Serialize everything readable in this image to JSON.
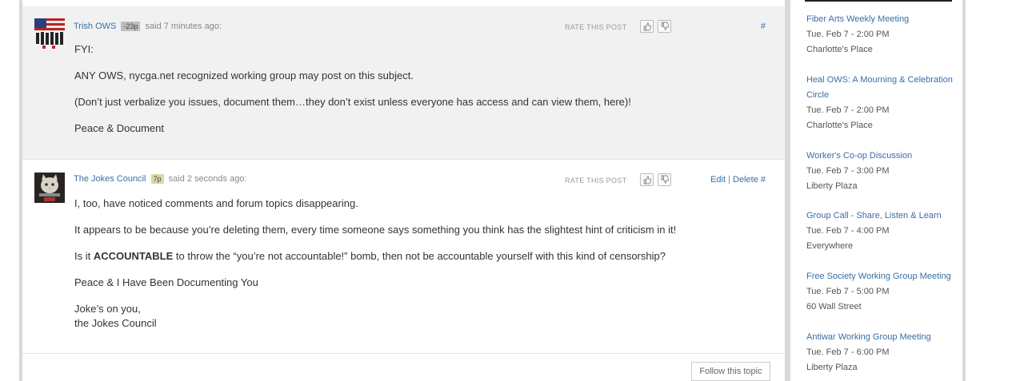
{
  "posts": [
    {
      "author": "Trish OWS",
      "rep": "-23p",
      "said": "said 7 minutes ago:",
      "rate_label": "RATE THIS POST",
      "actions": {
        "link": "#"
      },
      "body": [
        "FYI:",
        "ANY OWS, nycga.net recognized working group may post on this subject.",
        "(Don’t just verbalize you issues, document them…they don’t exist unless everyone has access and can view them, here)!",
        "Peace & Document"
      ]
    },
    {
      "author": "The Jokes Council",
      "rep": "7p",
      "said": "said 2 seconds ago:",
      "rate_label": "RATE THIS POST",
      "actions": {
        "edit": "Edit",
        "sep": "|",
        "delete": "Delete",
        "link": "#"
      },
      "body": {
        "line1": "I, too, have noticed comments and forum topics disappearing.",
        "line2": "It appears to be because you’re deleting them, every time someone says something you think has the slightest hint of criticism in it!",
        "line3_pre": "Is it ",
        "line3_bold": "ACCOUNTABLE",
        "line3_post": " to throw the “you’re not accountable!” bomb, then not be accountable yourself with this kind of censorship?",
        "line4": "Peace & I Have Been Documenting You",
        "line5a": "Joke’s on you,",
        "line5b": "the Jokes Council"
      }
    }
  ],
  "follow_button": "Follow this topic",
  "events": [
    {
      "title": "Fiber Arts Weekly Meeting",
      "time": "Tue. Feb 7 - 2:00 PM",
      "place": "Charlotte's Place"
    },
    {
      "title": "Heal OWS: A Mourning & Celebration Circle",
      "time": "Tue. Feb 7 - 2:00 PM",
      "place": "Charlotte's Place"
    },
    {
      "title": "Worker's Co-op Discussion",
      "time": "Tue. Feb 7 - 3:00 PM",
      "place": "Liberty Plaza"
    },
    {
      "title": "Group Call - Share, Listen & Learn",
      "time": "Tue. Feb 7 - 4:00 PM",
      "place": "Everywhere"
    },
    {
      "title": "Free Society Working Group Meeting",
      "time": "Tue. Feb 7 - 5:00 PM",
      "place": "60 Wall Street"
    },
    {
      "title": "Antiwar Working Group Meeting",
      "time": "Tue. Feb 7 - 6:00 PM",
      "place": "Liberty Plaza"
    }
  ],
  "colors": {
    "link": "#3a6ea5",
    "post_bg_alt": "#f1f1f1",
    "rail": "#d9d9d9"
  },
  "icons": [
    "flag-avatar-icon",
    "cat-avatar-icon",
    "thumbs-up-icon",
    "thumbs-down-icon"
  ]
}
